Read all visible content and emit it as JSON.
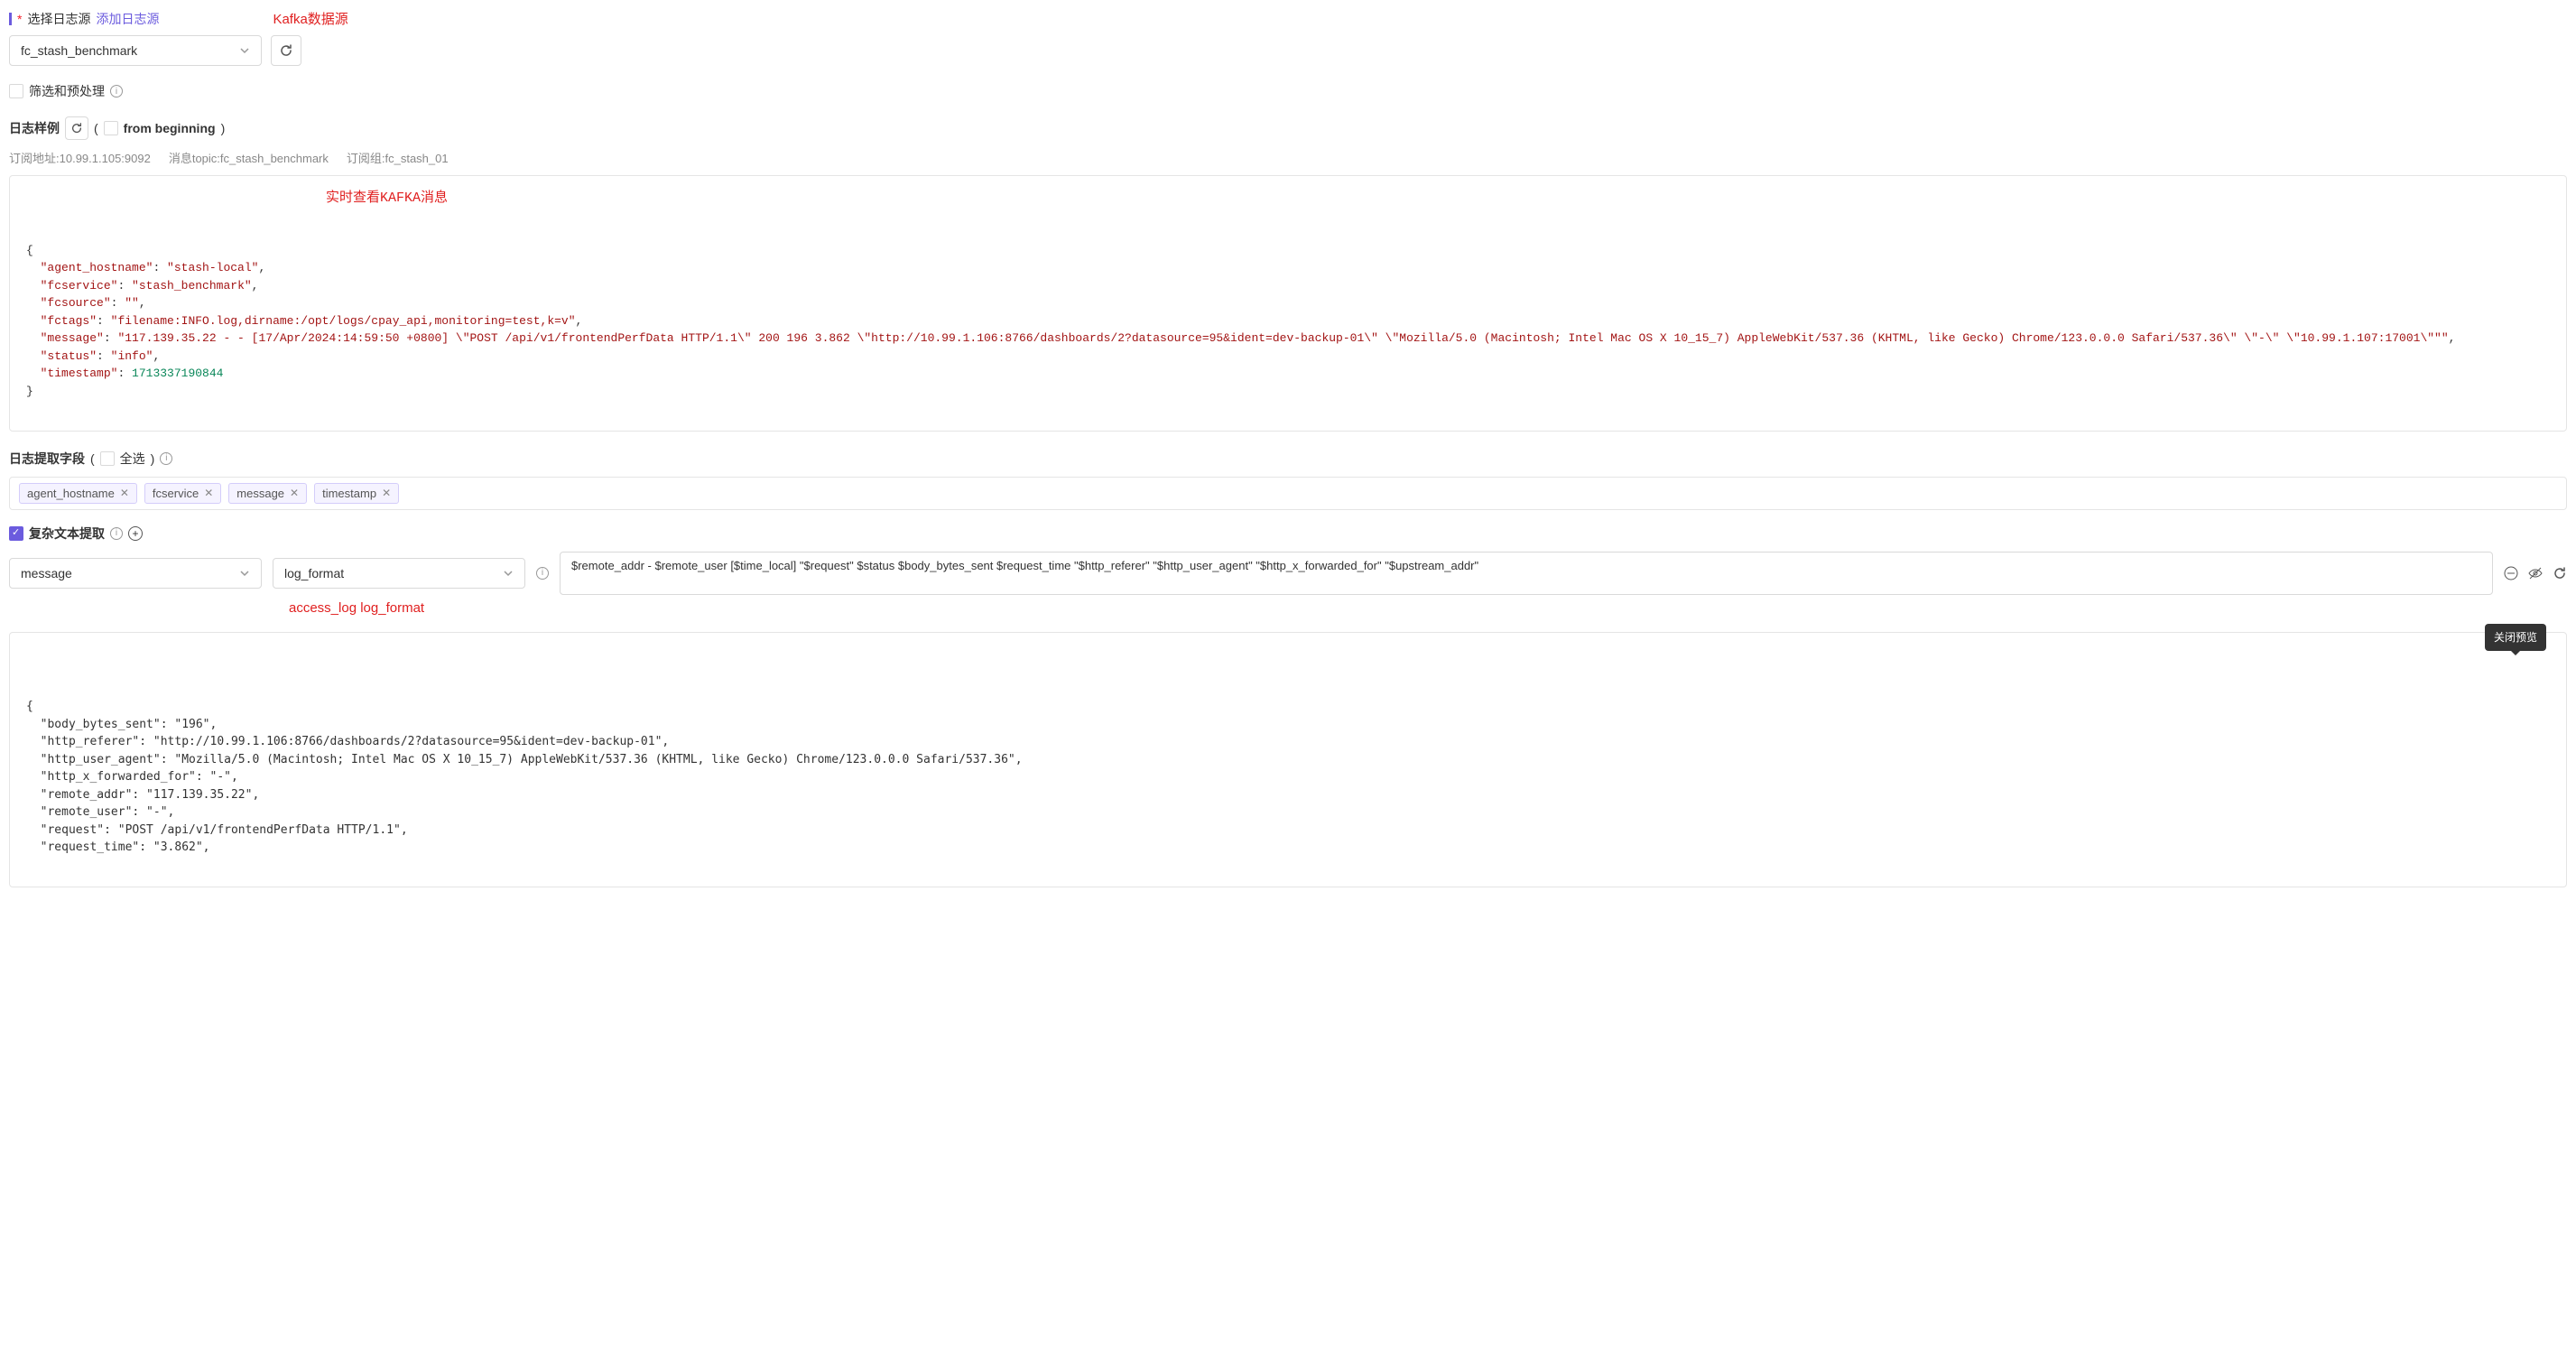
{
  "source": {
    "label": "选择日志源",
    "add_link": "添加日志源",
    "annotation": "Kafka数据源",
    "selected": "fc_stash_benchmark"
  },
  "filter": {
    "label": "筛选和预处理"
  },
  "sample": {
    "label": "日志样例",
    "paren_open": "(",
    "paren_close": ")",
    "from_beginning": "from beginning",
    "sub_addr_label": "订阅地址:",
    "sub_addr": "10.99.1.105:9092",
    "topic_label": "消息topic:",
    "topic": "fc_stash_benchmark",
    "group_label": "订阅组:",
    "group": "fc_stash_01",
    "annotation": "实时查看KAFKA消息"
  },
  "json_sample": {
    "agent_hostname": "stash-local",
    "fcservice": "stash_benchmark",
    "fcsource": "",
    "fctags": "filename:INFO.log,dirname:/opt/logs/cpay_api,monitoring=test,k=v",
    "message": "117.139.35.22 - - [17/Apr/2024:14:59:50 +0800] \\\"POST /api/v1/frontendPerfData HTTP/1.1\\\" 200 196 3.862 \\\"http://10.99.1.106:8766/dashboards/2?datasource=95&ident=dev-backup-01\\\" \\\"Mozilla/5.0 (Macintosh; Intel Mac OS X 10_15_7) AppleWebKit/537.36 (KHTML, like Gecko) Chrome/123.0.0.0 Safari/537.36\\\" \\\"-\\\" \\\"10.99.1.107:17001\\\"\"",
    "status": "info",
    "timestamp": 1713337190844
  },
  "extract_fields": {
    "label": "日志提取字段",
    "paren_open": "(",
    "paren_close": ")",
    "select_all": "全选",
    "tags": [
      "agent_hostname",
      "fcservice",
      "message",
      "timestamp"
    ]
  },
  "complex": {
    "label": "复杂文本提取",
    "field_select": "message",
    "method_select": "log_format",
    "format_value": "$remote_addr - $remote_user [$time_local] \"$request\" $status $body_bytes_sent $request_time \"$http_referer\" \"$http_user_agent\" \"$http_x_forwarded_for\" \"$upstream_addr\"",
    "annotation": "access_log log_format",
    "tooltip": "关闭预览"
  },
  "output_sample": {
    "body_bytes_sent": "196",
    "http_referer": "http://10.99.1.106:8766/dashboards/2?datasource=95&ident=dev-backup-01",
    "http_user_agent": "Mozilla/5.0 (Macintosh; Intel Mac OS X 10_15_7) AppleWebKit/537.36 (KHTML, like Gecko) Chrome/123.0.0.0 Safari/537.36",
    "http_x_forwarded_for": "-",
    "remote_addr": "117.139.35.22",
    "remote_user": "-",
    "request": "POST /api/v1/frontendPerfData HTTP/1.1",
    "request_time": "3.862"
  }
}
